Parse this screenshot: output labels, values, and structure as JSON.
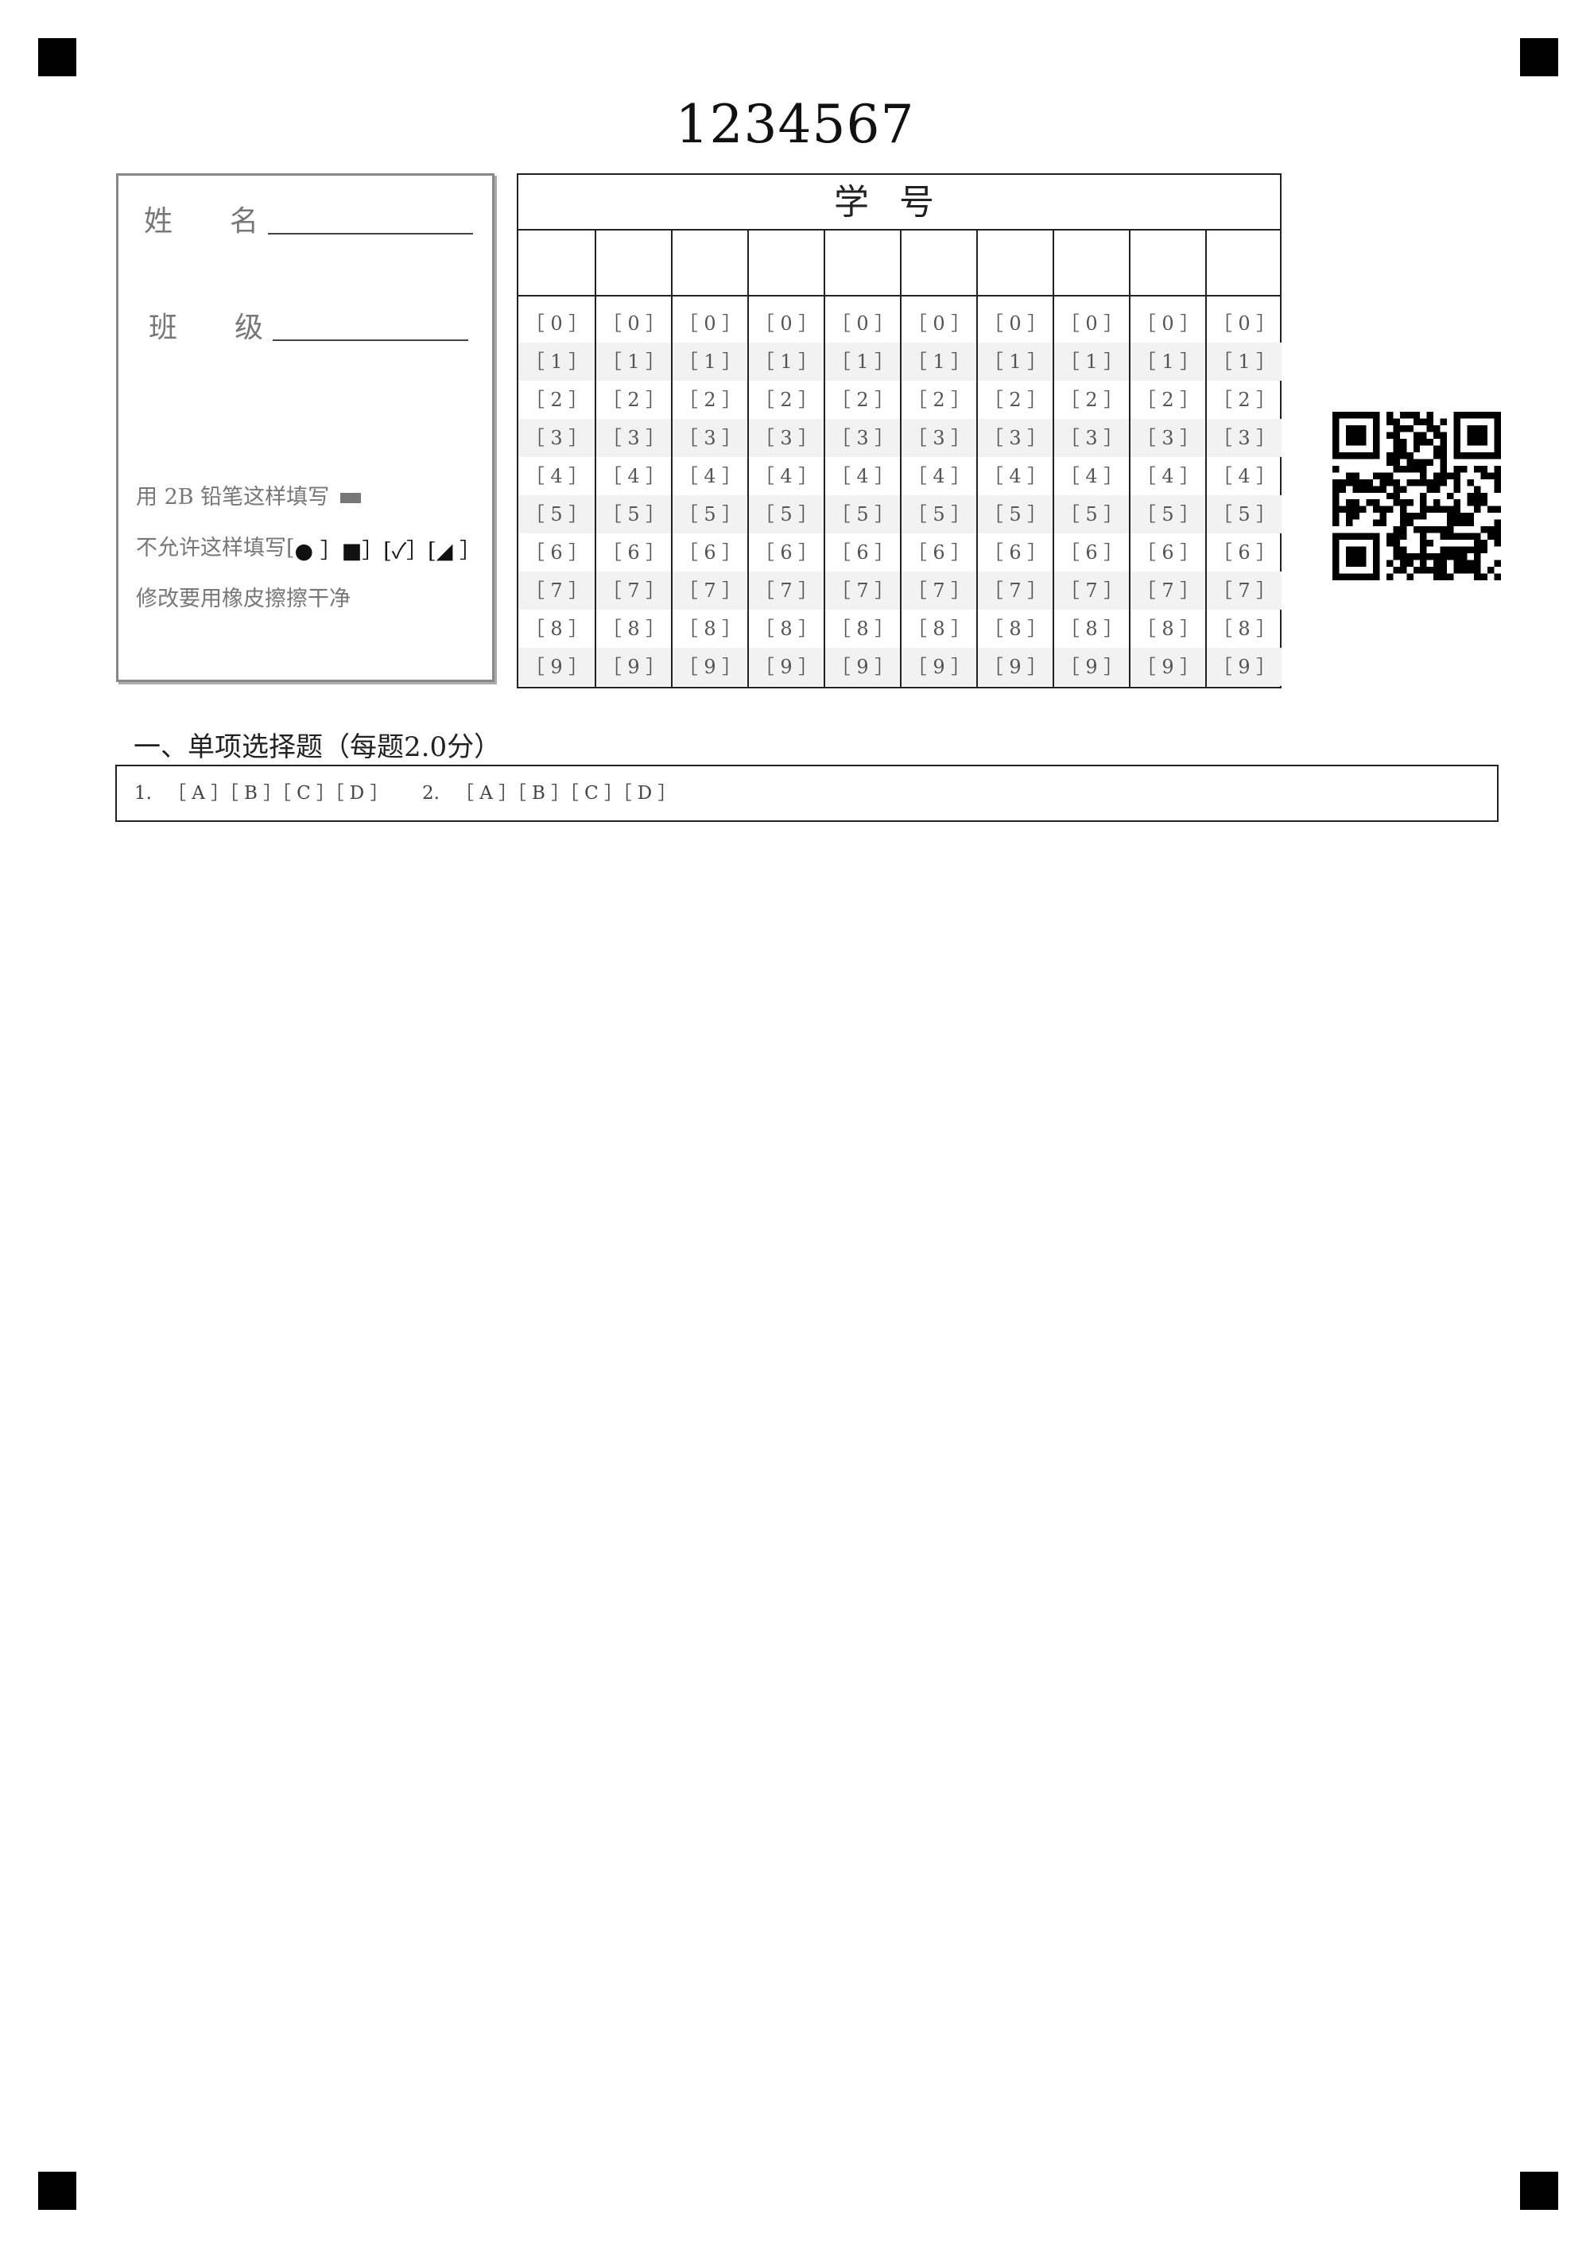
{
  "exam_id": "1234567",
  "info": {
    "name_label": "姓　　名",
    "class_label": "班　　级",
    "instructions": {
      "correct_fill": "用 2B 铅笔这样填写",
      "wrong_fill_prefix": "不允许这样填写[",
      "wrong_fill_samples": " ● ］■］[✓］[◢ ］",
      "erase": "修改要用橡皮擦擦干净"
    }
  },
  "student_id": {
    "title": "学号",
    "column_count": 10,
    "options": [
      "［ 0 ］",
      "［ 1 ］",
      "［ 2 ］",
      "［ 3 ］",
      "［ 4 ］",
      "［ 5 ］",
      "［ 6 ］",
      "［ 7 ］",
      "［ 8 ］",
      "［ 9 ］"
    ]
  },
  "section": {
    "title": "一、单项选择题（每题2.0分）",
    "questions": [
      {
        "number": "1.",
        "options": "［ A ］［ B ］［ C ］［ D ］"
      },
      {
        "number": "2.",
        "options": "［ A ］［ B ］［ C ］［ D ］"
      }
    ]
  },
  "colors": {
    "ink": "#222222",
    "muted": "#777777",
    "shade": "#f2f2f2"
  }
}
